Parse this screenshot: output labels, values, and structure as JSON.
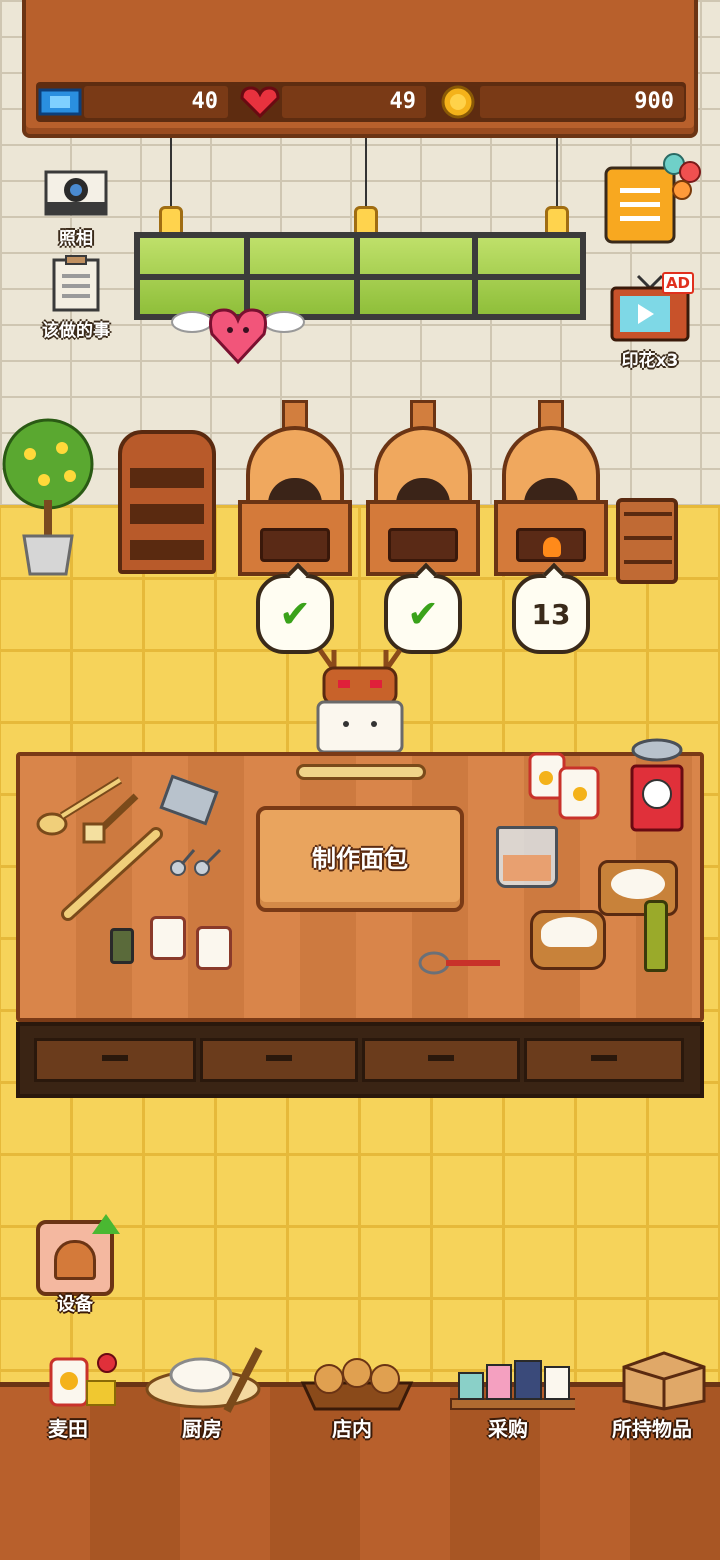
{
  "resources": {
    "tickets": "40",
    "hearts": "49",
    "coins": "900"
  },
  "side_buttons": {
    "camera": "照相",
    "todo": "该做的事",
    "stamps": "印花x3",
    "ad_badge": "AD"
  },
  "ovens": [
    {
      "status": "done",
      "icon": "check-icon"
    },
    {
      "status": "done",
      "icon": "check-icon"
    },
    {
      "status": "timer",
      "value": "13"
    }
  ],
  "table": {
    "make_bread_label": "制作面包"
  },
  "equipment": {
    "label": "设备"
  },
  "nav": {
    "items": [
      {
        "label": "麦田",
        "icon": "wheat-field-icon"
      },
      {
        "label": "厨房",
        "icon": "kitchen-icon"
      },
      {
        "label": "店内",
        "icon": "shop-icon"
      },
      {
        "label": "采购",
        "icon": "purchase-icon"
      },
      {
        "label": "所持物品",
        "icon": "inventory-box-icon"
      }
    ]
  },
  "colors": {
    "wall": "#ece6d6",
    "floor": "#f6d35a",
    "wood": "#b8602c",
    "check": "#3aa21a"
  }
}
